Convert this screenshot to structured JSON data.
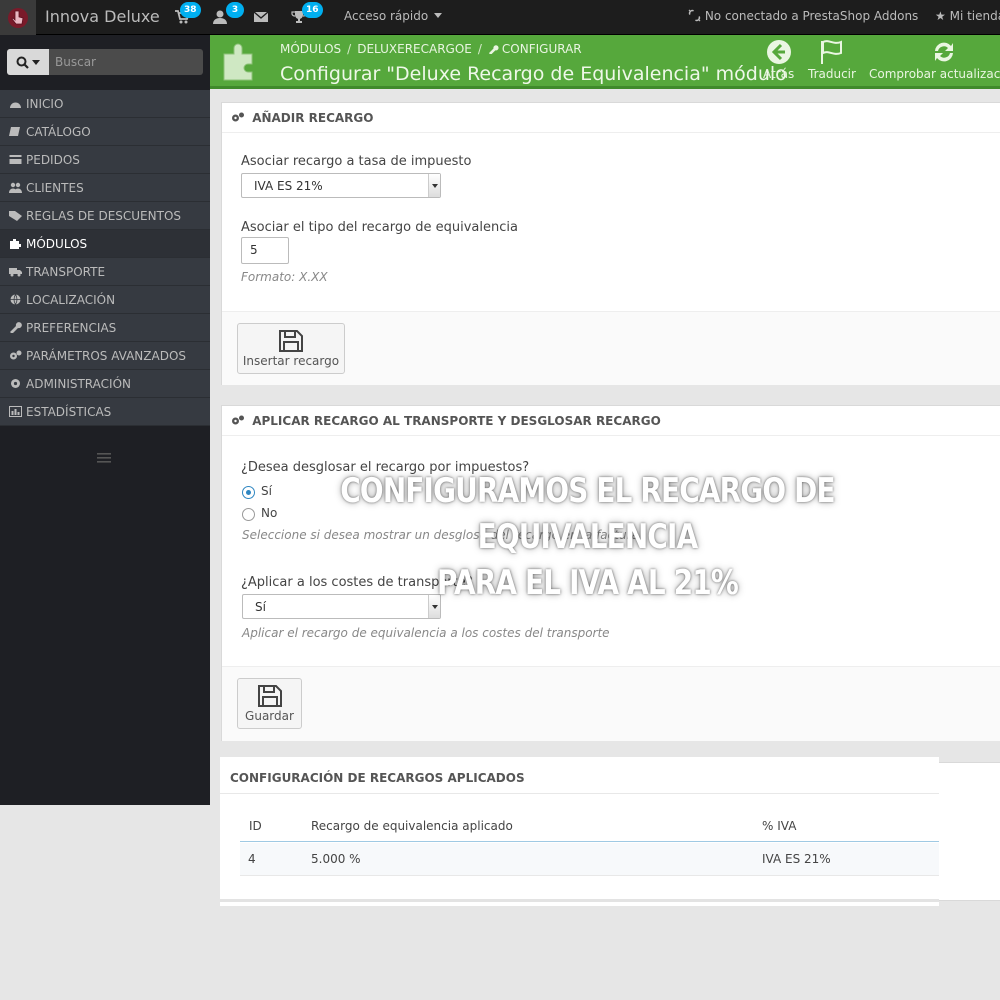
{
  "topbar": {
    "shop_name": "Innova Deluxe",
    "orders_badge": "38",
    "customers_badge": "3",
    "trophy_badge": "16",
    "quick_access": "Acceso rápido",
    "addons_status": "No conectado a PrestaShop Addons",
    "my_shop": "Mi tienda"
  },
  "sidebar": {
    "search_placeholder": "Buscar",
    "items": [
      {
        "label": "Inicio",
        "icon": "dashboard-icon"
      },
      {
        "label": "Catálogo",
        "icon": "book-icon"
      },
      {
        "label": "Pedidos",
        "icon": "credit-card-icon"
      },
      {
        "label": "Clientes",
        "icon": "users-icon"
      },
      {
        "label": "Reglas de descuentos",
        "icon": "tag-icon"
      },
      {
        "label": "Módulos",
        "icon": "puzzle-icon"
      },
      {
        "label": "Transporte",
        "icon": "truck-icon"
      },
      {
        "label": "Localización",
        "icon": "globe-icon"
      },
      {
        "label": "Preferencias",
        "icon": "wrench-icon"
      },
      {
        "label": "Parámetros avanzados",
        "icon": "cogs-icon"
      },
      {
        "label": "Administración",
        "icon": "cog-icon"
      },
      {
        "label": "Estadísticas",
        "icon": "bar-chart-icon"
      }
    ],
    "active_index": 5
  },
  "header": {
    "breadcrumb": [
      "Módulos",
      "deluxerecargoe",
      "Configurar"
    ],
    "title": "Configurar \"Deluxe Recargo de Equivalencia\" módulo",
    "back_label": "Atrás",
    "translate_label": "Traducir",
    "check_update_label": "Comprobar actualización"
  },
  "add_panel": {
    "heading": "Añadir recargo",
    "tax_label": "Asociar recargo a tasa de impuesto",
    "tax_value": "IVA ES 21%",
    "type_label": "Asociar el tipo del recargo de equivalencia",
    "type_value": "5",
    "format_help": "Formato: X.XX",
    "insert_button": "Insertar recargo"
  },
  "apply_panel": {
    "heading": "Aplicar recargo al transporte y desglosar recargo",
    "breakdown_question": "¿Desea desglosar el recargo por impuestos?",
    "option_yes": "Sí",
    "option_no": "No",
    "breakdown_help": "Seleccione si desea mostrar un desglose del recargo en la factura",
    "shipping_question": "¿Aplicar a los costes de transporte?",
    "shipping_value": "Sí",
    "shipping_help": "Aplicar el recargo de equivalencia a los costes del transporte",
    "save_button": "Guardar"
  },
  "applied_panel": {
    "heading": "Configuración de recargos aplicados",
    "columns": [
      "ID",
      "Recargo de equivalencia aplicado",
      "% IVA"
    ],
    "rows": [
      {
        "id": "4",
        "surcharge": "5.000 %",
        "tax": "IVA ES 21%"
      }
    ]
  },
  "overlay": {
    "line1": "Configuramos el recargo de equivalencia",
    "line2": "para el IVA al 21%"
  },
  "colors": {
    "header_green": "#56a83c",
    "sidebar_bg": "#363a41",
    "badge_blue": "#00aff0"
  }
}
